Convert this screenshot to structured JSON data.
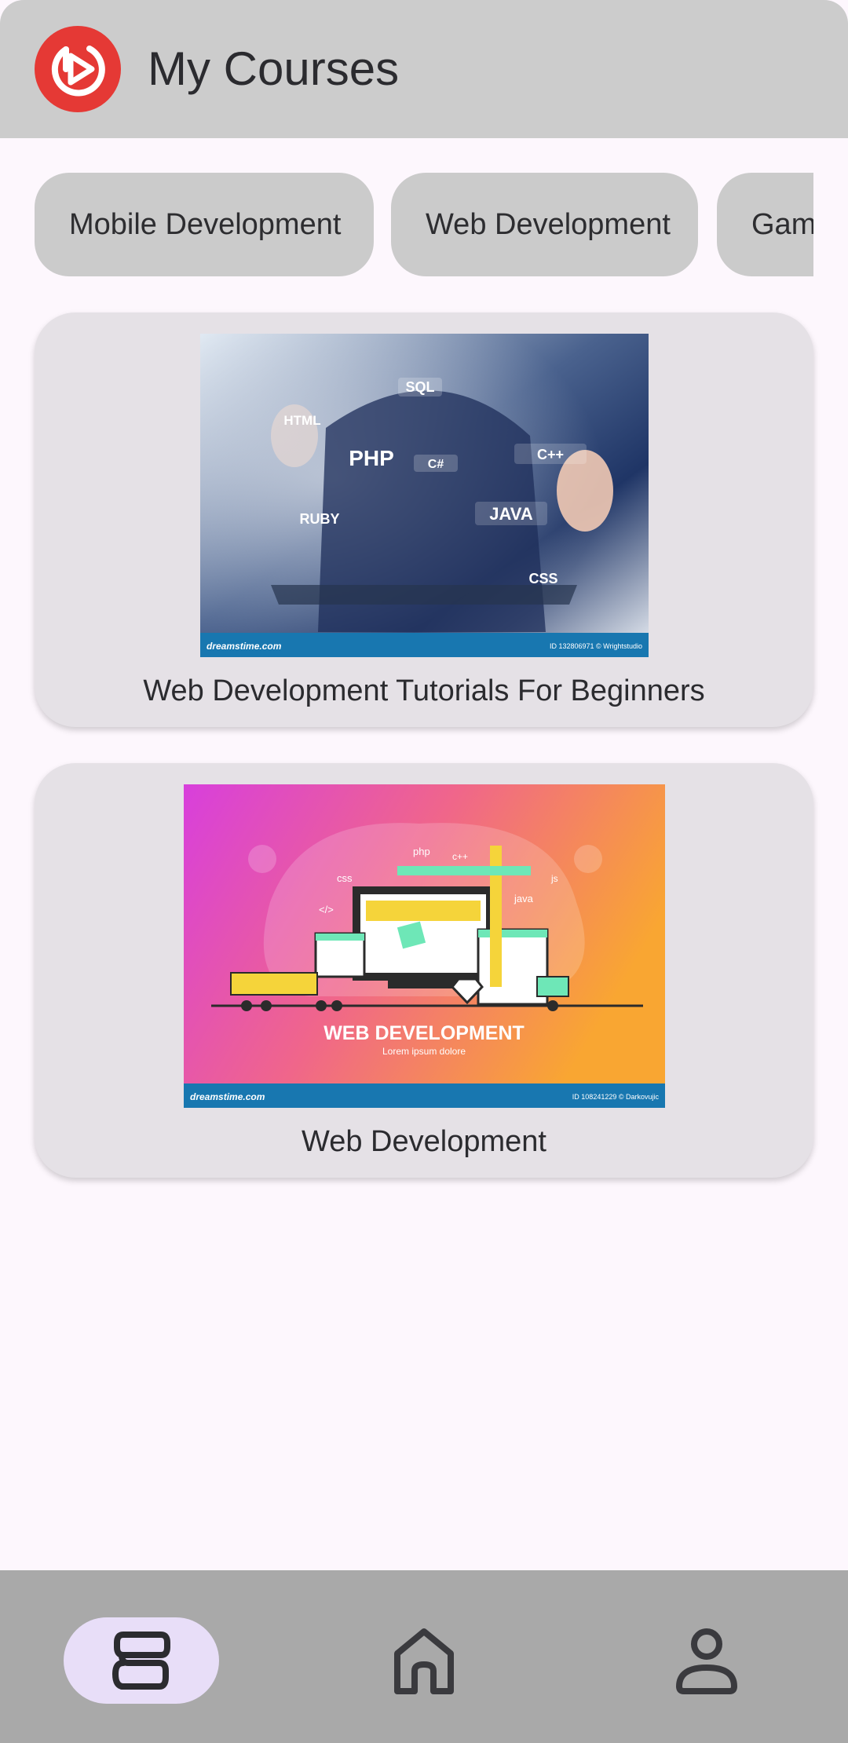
{
  "app_bar": {
    "title": "My Courses",
    "logo_icon": "play-logo-icon",
    "accent_color": "#e53935"
  },
  "categories": [
    {
      "label": "Mobile Development"
    },
    {
      "label": "Web Development"
    },
    {
      "label": "Gam"
    }
  ],
  "courses": [
    {
      "title": "Web Development Tutorials For Beginners",
      "thumbnail": {
        "tags": [
          "SQL",
          "HTML",
          "PHP",
          "C#",
          "C++",
          "RUBY",
          "JAVA",
          "CSS"
        ],
        "footer_brand": "dreamstime.com",
        "footer_id": "ID 132806971 © Wrightstudio"
      }
    },
    {
      "title": "Web Development",
      "thumbnail": {
        "headline": "WEB DEVELOPMENT",
        "subline": "Lorem ipsum dolore",
        "tags": [
          "php",
          "c++",
          "css",
          "js",
          "java",
          "</>"
        ],
        "footer_brand": "dreamstime.com",
        "footer_id": "ID 108241229 © Darkovujic"
      }
    }
  ],
  "bottom_nav": {
    "items": [
      {
        "icon": "courses-icon",
        "selected": true
      },
      {
        "icon": "home-icon",
        "selected": false
      },
      {
        "icon": "profile-icon",
        "selected": false
      }
    ],
    "selected_color": "#e8def8"
  }
}
